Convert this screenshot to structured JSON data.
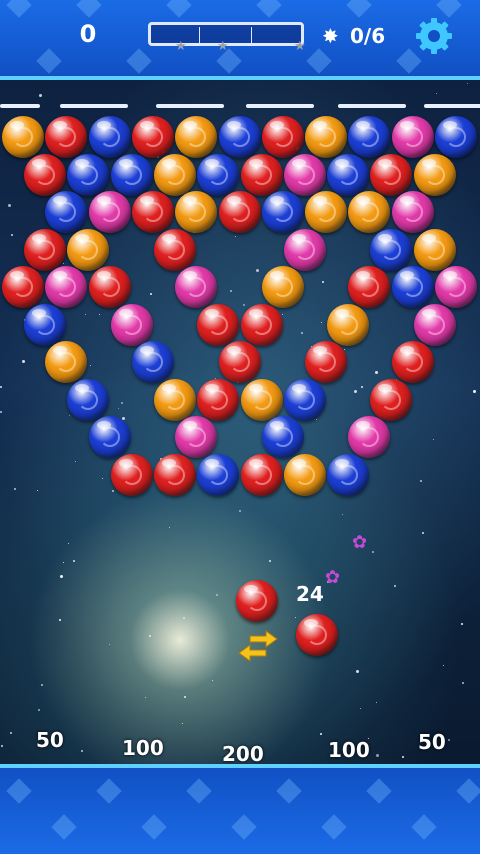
{
  "hud": {
    "score": "0",
    "progress_fraction": 0,
    "stars_label": "0/6",
    "star_icon": "✸"
  },
  "colors": {
    "red": "#e02020",
    "blue": "#1c3fd6",
    "orange": "#f39a12",
    "pink": "#e23aa9",
    "hud_blue": "#1b6be6",
    "accent": "#5fd0ff"
  },
  "grid": [
    [
      "O",
      "R",
      "B",
      "R",
      "O",
      "B",
      "R",
      "O",
      "B",
      "P",
      "B"
    ],
    [
      "R",
      "B",
      "B",
      "O",
      "B",
      "R",
      "P",
      "B",
      "R",
      "O"
    ],
    [
      null,
      "B",
      "P",
      "R",
      "O",
      "R",
      "B",
      "O",
      "O",
      "P",
      null
    ],
    [
      "R",
      "O",
      null,
      "R",
      null,
      null,
      "P",
      null,
      "B",
      "O"
    ],
    [
      "R",
      "P",
      "R",
      null,
      "P",
      null,
      "O",
      null,
      "R",
      "B",
      "P"
    ],
    [
      "B",
      null,
      "P",
      null,
      "R",
      "R",
      null,
      "O",
      null,
      "P"
    ],
    [
      null,
      "O",
      null,
      "B",
      null,
      "R",
      null,
      "R",
      null,
      "R",
      null
    ],
    [
      null,
      "B",
      null,
      "O",
      "R",
      "O",
      "B",
      null,
      "R",
      null
    ],
    [
      null,
      null,
      "B",
      null,
      "P",
      null,
      "B",
      null,
      "P",
      null,
      null
    ],
    [
      null,
      null,
      "R",
      "R",
      "B",
      "R",
      "O",
      "B",
      null,
      null
    ]
  ],
  "shooter": {
    "current_bubble": "R",
    "next_bubble": "R",
    "shots_left": "24",
    "swap_icon": "swap-arrows-icon"
  },
  "bottom_scores": [
    "50",
    "100",
    "200",
    "100",
    "50"
  ]
}
